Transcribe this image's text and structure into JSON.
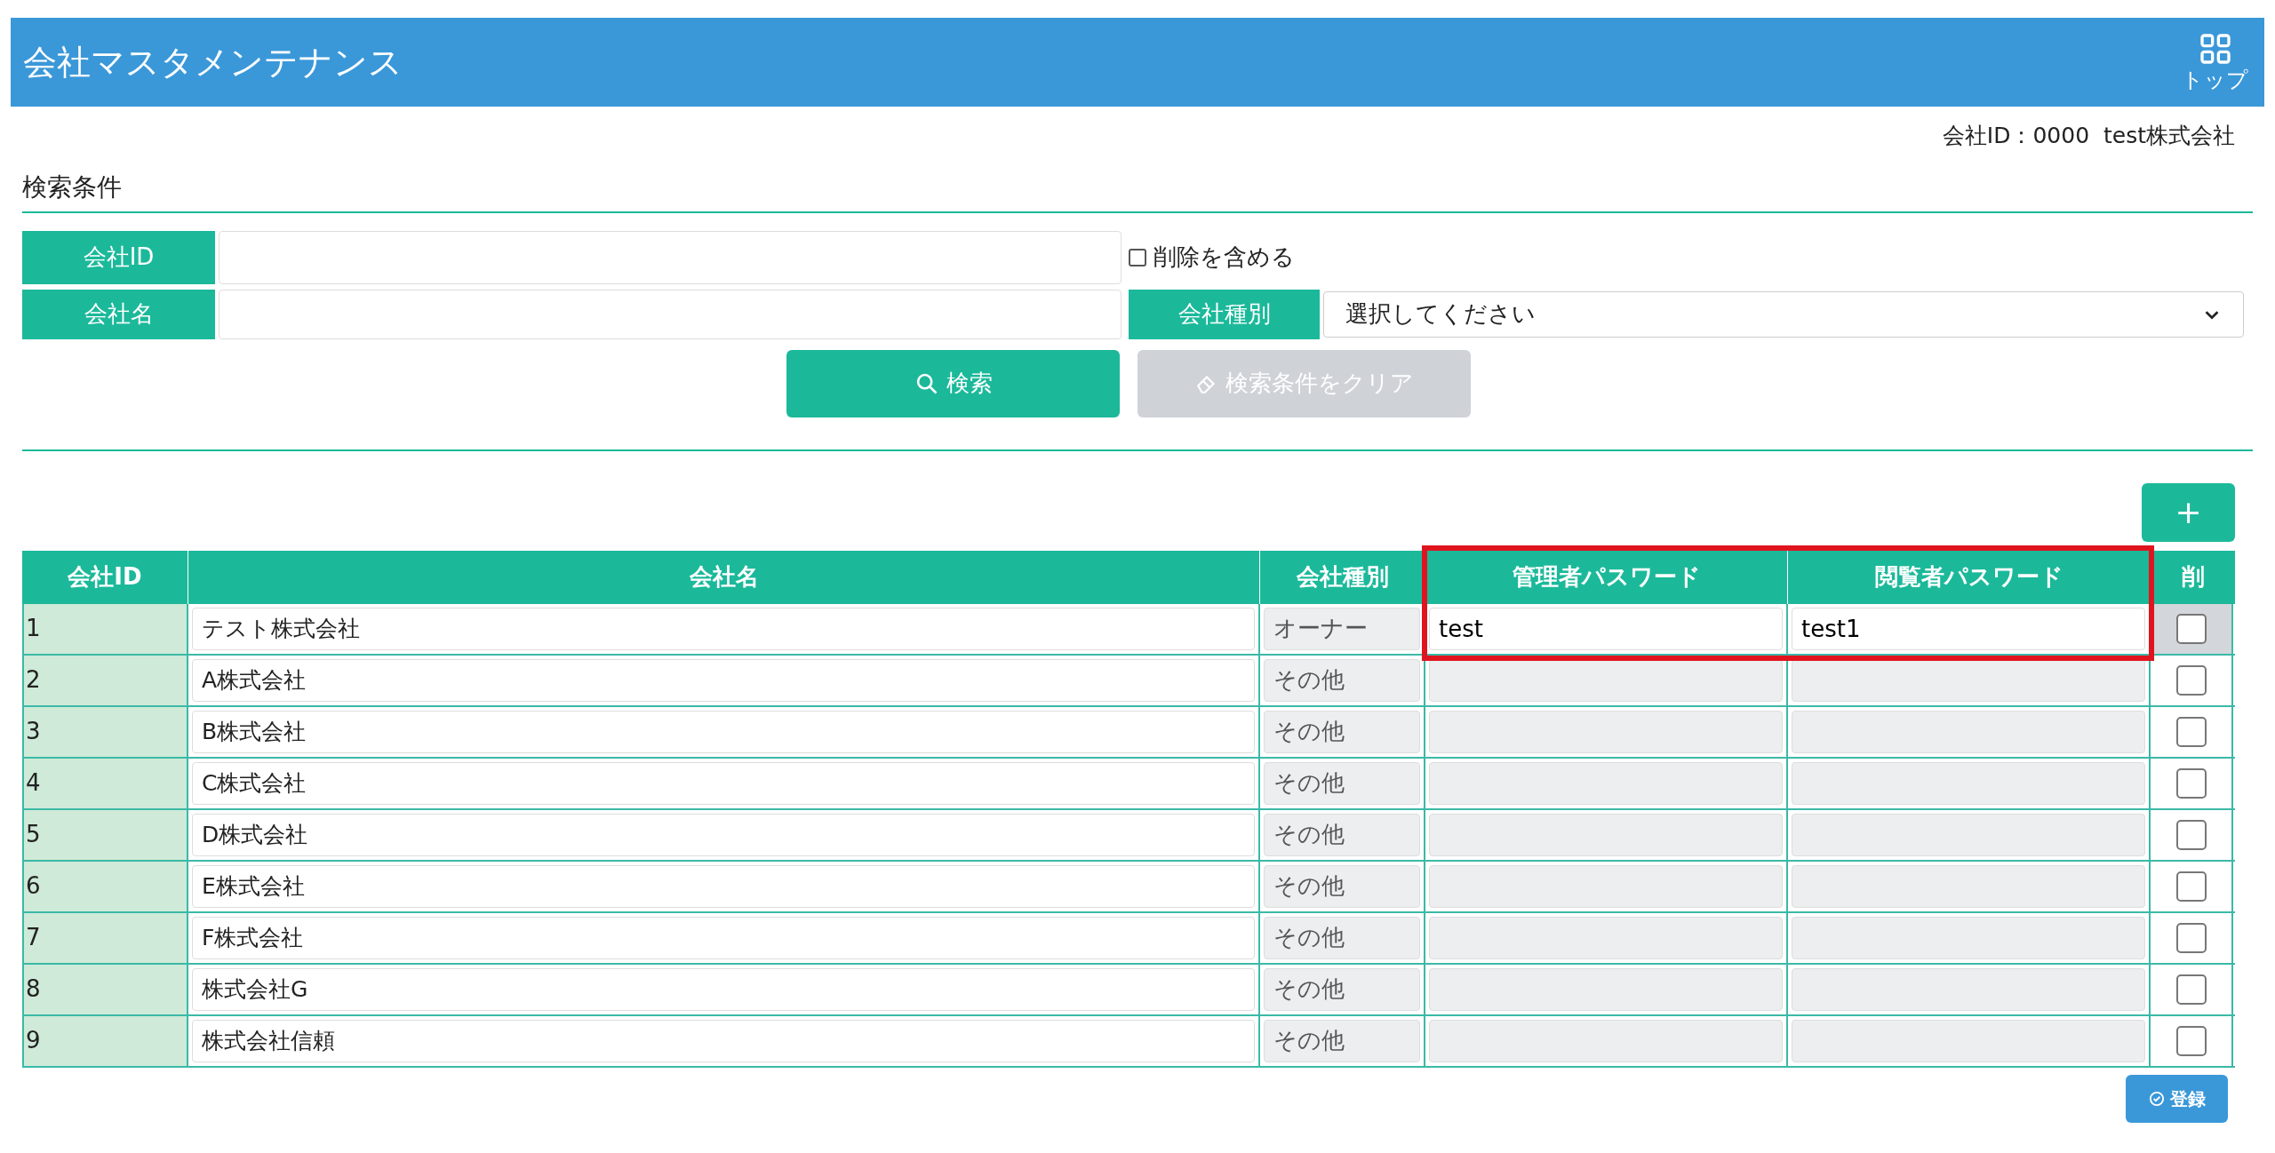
{
  "header": {
    "title": "会社マスタメンテナンス",
    "top_label": "トップ"
  },
  "user_info": "会社ID：0000  test株式会社",
  "search": {
    "heading": "検索条件",
    "company_id": {
      "label": "会社ID"
    },
    "include_deleted": {
      "label": "削除を含める",
      "checked": false
    },
    "company_name": {
      "label": "会社名"
    },
    "company_type": {
      "label": "会社種別",
      "placeholder": "選択してください"
    },
    "search_button": "検索",
    "clear_button": {
      "label": "検索条件をクリア",
      "disabled": true
    }
  },
  "add_button": "+",
  "table": {
    "columns": [
      "会社ID",
      "会社名",
      "会社種別",
      "管理者パスワード",
      "閲覧者パスワード",
      "削"
    ],
    "highlight": true,
    "rows": [
      {
        "id": "1",
        "name": "テスト株式会社",
        "kind": "オーナー",
        "admin_password": "test",
        "viewer_password": "test1",
        "password_editable": true,
        "delete_checked": false,
        "delete_disabled": true
      },
      {
        "id": "2",
        "name": "A株式会社",
        "kind": "その他",
        "password_editable": false,
        "delete_checked": false,
        "delete_disabled": false
      },
      {
        "id": "3",
        "name": "B株式会社",
        "kind": "その他",
        "password_editable": false,
        "delete_checked": false,
        "delete_disabled": false
      },
      {
        "id": "4",
        "name": "C株式会社",
        "kind": "その他",
        "password_editable": false,
        "delete_checked": false,
        "delete_disabled": false
      },
      {
        "id": "5",
        "name": "D株式会社",
        "kind": "その他",
        "password_editable": false,
        "delete_checked": false,
        "delete_disabled": false
      },
      {
        "id": "6",
        "name": "E株式会社",
        "kind": "その他",
        "password_editable": false,
        "delete_checked": false,
        "delete_disabled": false
      },
      {
        "id": "7",
        "name": "F株式会社",
        "kind": "その他",
        "password_editable": false,
        "delete_checked": false,
        "delete_disabled": false
      },
      {
        "id": "8",
        "name": "株式会社G",
        "kind": "その他",
        "password_editable": false,
        "delete_checked": false,
        "delete_disabled": false
      },
      {
        "id": "9",
        "name": "株式会社信頼",
        "kind": "その他",
        "password_editable": false,
        "delete_checked": false,
        "delete_disabled": false
      }
    ]
  },
  "register_button": "登録"
}
